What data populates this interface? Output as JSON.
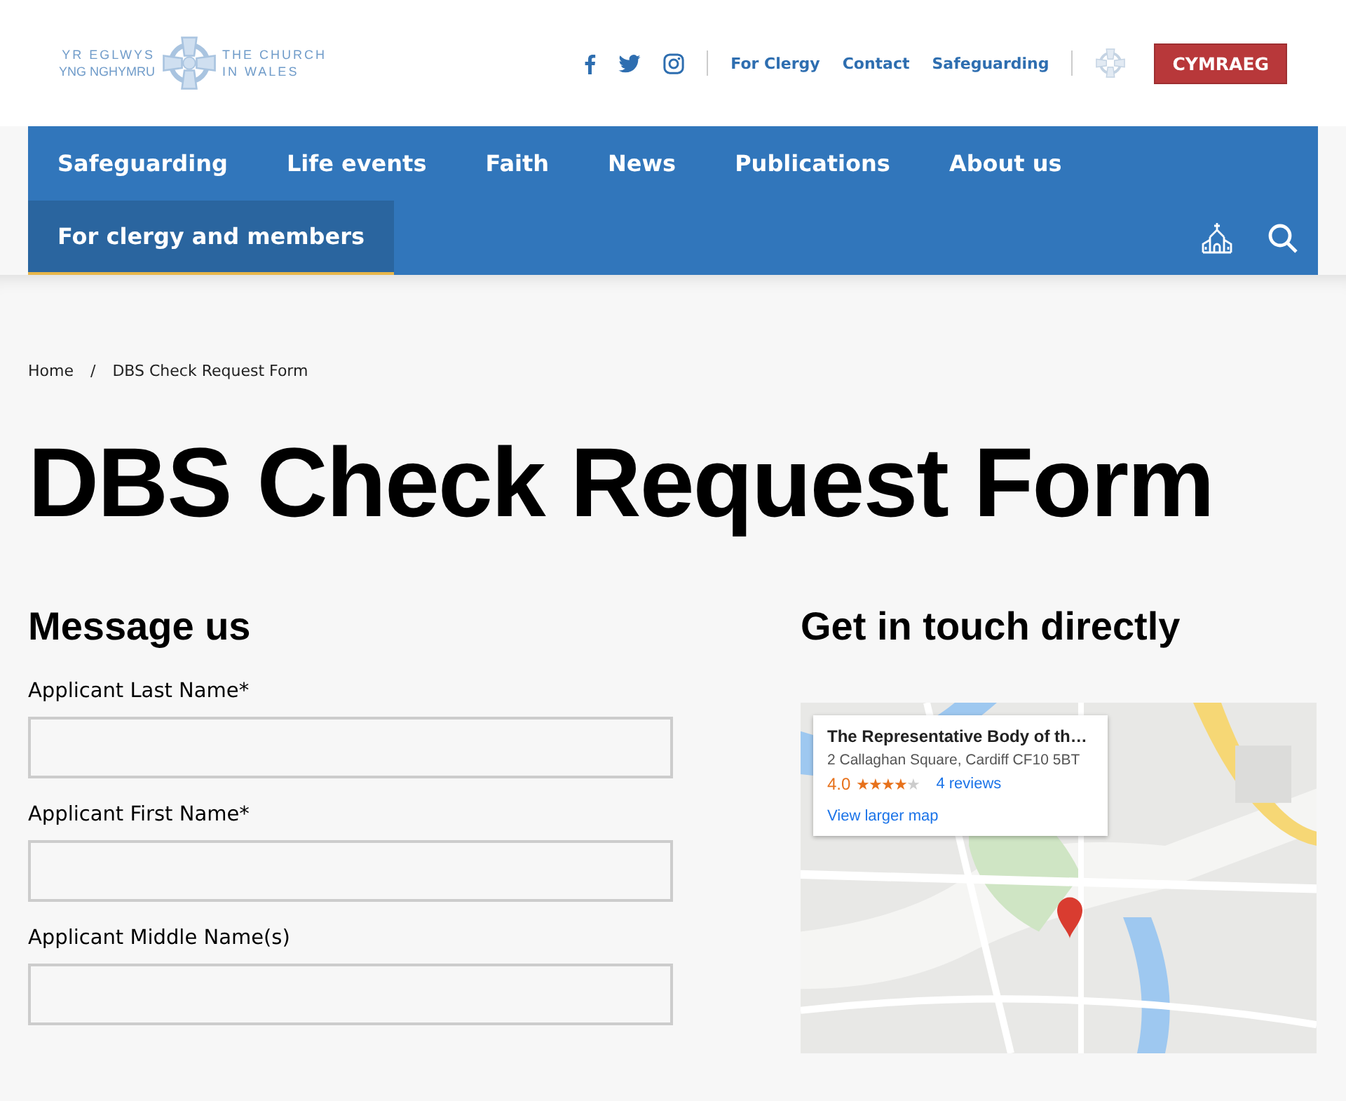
{
  "logo": {
    "welsh_line_1": "YR EGLWYS",
    "welsh_line_2": "YNG NGHYMRU",
    "english_line_1": "THE CHURCH",
    "english_line_2": "IN WALES"
  },
  "top_links": [
    "For Clergy",
    "Contact",
    "Safeguarding"
  ],
  "language_button": "CYMRAEG",
  "nav": [
    {
      "label": "Safeguarding",
      "selected": false
    },
    {
      "label": "Life events",
      "selected": false
    },
    {
      "label": "Faith",
      "selected": false
    },
    {
      "label": "News",
      "selected": false
    },
    {
      "label": "Publications",
      "selected": false
    },
    {
      "label": "About us",
      "selected": false
    },
    {
      "label": "For clergy and members",
      "selected": true
    }
  ],
  "breadcrumb": [
    "Home",
    "DBS Check Request Form"
  ],
  "breadcrumb_separator": "/",
  "title": "DBS Check Request Form",
  "form": {
    "heading": "Message us",
    "fields": [
      {
        "label": "Applicant Last Name*"
      },
      {
        "label": "Applicant First Name*"
      },
      {
        "label": "Applicant Middle Name(s)"
      }
    ]
  },
  "contact": {
    "heading": "Get in touch directly",
    "map_card": {
      "name": "The Representative Body of th…",
      "address": "2 Callaghan Square, Cardiff CF10 5BT",
      "rating": "4.0",
      "stars": 4,
      "reviews": "4 reviews",
      "link": "View larger map"
    }
  }
}
